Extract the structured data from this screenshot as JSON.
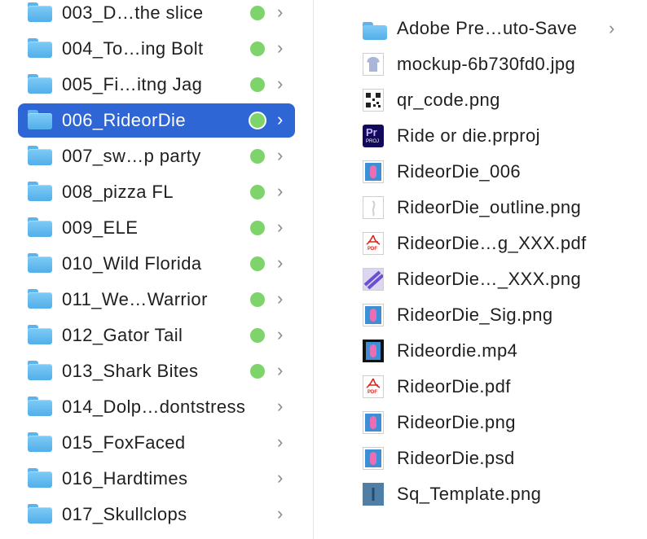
{
  "folders": [
    {
      "name": "003_D…the slice",
      "tag": true,
      "selected": false
    },
    {
      "name": "004_To…ing Bolt",
      "tag": true,
      "selected": false
    },
    {
      "name": "005_Fi…itng Jag",
      "tag": true,
      "selected": false
    },
    {
      "name": "006_RideorDie",
      "tag": true,
      "selected": true
    },
    {
      "name": "007_sw…p party",
      "tag": true,
      "selected": false
    },
    {
      "name": "008_pizza FL",
      "tag": true,
      "selected": false
    },
    {
      "name": "009_ELE",
      "tag": true,
      "selected": false
    },
    {
      "name": "010_Wild Florida",
      "tag": true,
      "selected": false
    },
    {
      "name": "011_We…Warrior",
      "tag": true,
      "selected": false
    },
    {
      "name": "012_Gator Tail",
      "tag": true,
      "selected": false
    },
    {
      "name": "013_Shark Bites",
      "tag": true,
      "selected": false
    },
    {
      "name": "014_Dolp…dontstress",
      "tag": false,
      "selected": false
    },
    {
      "name": "015_FoxFaced",
      "tag": false,
      "selected": false
    },
    {
      "name": "016_Hardtimes",
      "tag": false,
      "selected": false
    },
    {
      "name": "017_Skullclops",
      "tag": false,
      "selected": false
    }
  ],
  "files": [
    {
      "name": "Adobe Pre…uto-Save",
      "icon": "folder-icon",
      "chevron": true
    },
    {
      "name": "mockup-6b730fd0.jpg",
      "icon": "shirt-thumbnail-icon",
      "chevron": false
    },
    {
      "name": "qr_code.png",
      "icon": "qr-code-icon",
      "chevron": false
    },
    {
      "name": "Ride or die.prproj",
      "icon": "premiere-project-icon",
      "chevron": false
    },
    {
      "name": "RideorDie_006",
      "icon": "image-thumbnail-icon",
      "chevron": false
    },
    {
      "name": "RideorDie_outline.png",
      "icon": "outline-thumbnail-icon",
      "chevron": false
    },
    {
      "name": "RideorDie…g_XXX.pdf",
      "icon": "pdf-icon",
      "chevron": false
    },
    {
      "name": "RideorDie…_XXX.png",
      "icon": "pattern-thumbnail-icon",
      "chevron": false
    },
    {
      "name": "RideorDie_Sig.png",
      "icon": "image-thumbnail-icon",
      "chevron": false
    },
    {
      "name": "Rideordie.mp4",
      "icon": "video-thumbnail-icon",
      "chevron": false
    },
    {
      "name": "RideorDie.pdf",
      "icon": "pdf-icon",
      "chevron": false
    },
    {
      "name": "RideorDie.png",
      "icon": "image-thumbnail-icon",
      "chevron": false
    },
    {
      "name": "RideorDie.psd",
      "icon": "image-thumbnail-icon",
      "chevron": false
    },
    {
      "name": "Sq_Template.png",
      "icon": "template-thumbnail-icon",
      "chevron": false
    }
  ],
  "icons": {
    "pr_label": "Pr",
    "proj_label": "PROJ",
    "pdf_label": "PDF",
    "chevron_glyph": "›"
  },
  "colors": {
    "selection": "#2f66d6",
    "green_tag": "#7ed46b",
    "folder_blue": "#52aeea"
  }
}
